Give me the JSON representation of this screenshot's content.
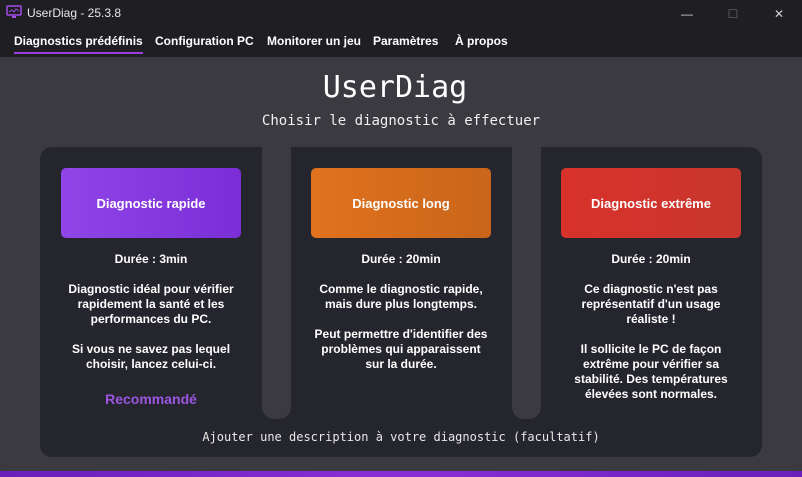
{
  "window": {
    "title": "UserDiag - 25.3.8",
    "minimize": "—",
    "maximize": "☐",
    "close": "✕"
  },
  "menu": {
    "items": [
      {
        "label": "Diagnostics prédéfinis",
        "active": true
      },
      {
        "label": "Configuration PC"
      },
      {
        "label": "Monitorer un jeu"
      },
      {
        "label": "Paramètres"
      },
      {
        "label": "À propos"
      }
    ]
  },
  "main": {
    "title": "UserDiag",
    "subtitle": "Choisir le diagnostic à effectuer"
  },
  "cards": [
    {
      "button": "Diagnostic rapide",
      "duration": "Durée : 3min",
      "desc1": "Diagnostic idéal pour vérifier\nrapidement la santé et les\nperformances du PC.",
      "desc2": "Si vous ne savez pas lequel\nchoisir, lancez celui-ci.",
      "badge": "Recommandé",
      "color": "#8f45e8"
    },
    {
      "button": "Diagnostic long",
      "duration": "Durée : 20min",
      "desc1": "Comme le diagnostic rapide,\nmais dure plus longtemps.",
      "desc2": "Peut permettre d'identifier des\nproblèmes qui apparaissent\nsur la durée.",
      "color": "#e0721e"
    },
    {
      "button": "Diagnostic extrême",
      "duration": "Durée : 20min",
      "desc1": "Ce diagnostic n'est pas\nreprésentatif d'un usage\nréaliste !",
      "desc2": "Il sollicite le PC de façon\nextrême pour vérifier sa\nstabilité. Des températures\nélevées sont normales.",
      "color": "#d8322a"
    }
  ],
  "footer": {
    "description_prompt": "Ajouter une description à votre diagnostic (facultatif)"
  },
  "colors": {
    "accent": "#9b3fe0",
    "background": "#3a3a40",
    "panel": "#25252d"
  }
}
